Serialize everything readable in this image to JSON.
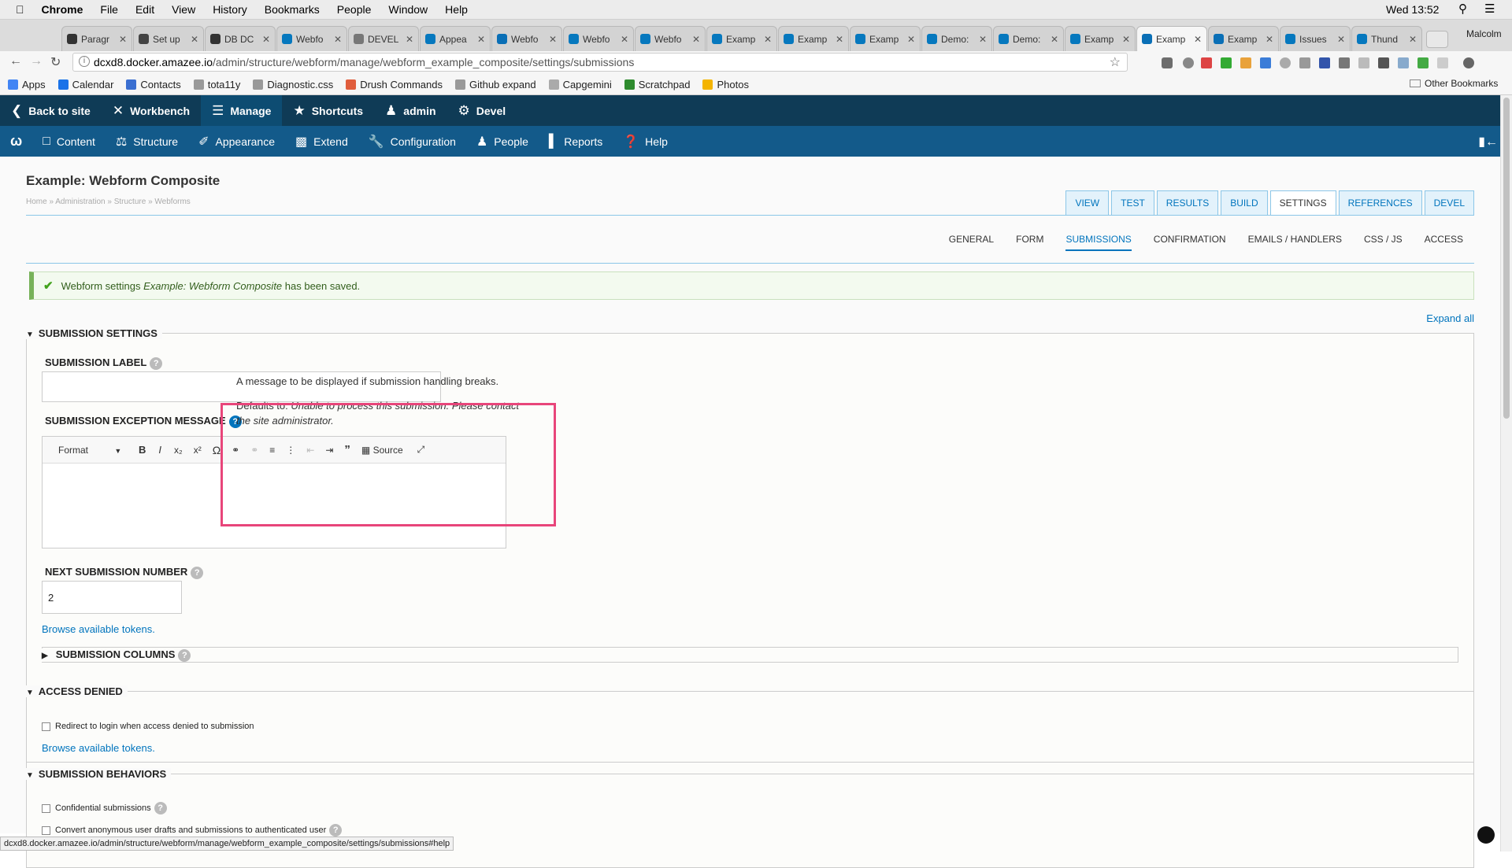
{
  "menubar": {
    "apple": "",
    "app": "Chrome",
    "items": [
      "File",
      "Edit",
      "View",
      "History",
      "Bookmarks",
      "People",
      "Window",
      "Help"
    ],
    "clock": "Wed 13:52"
  },
  "tabs": [
    {
      "label": "Paragr",
      "color": "#333"
    },
    {
      "label": "Set up",
      "color": "#444"
    },
    {
      "label": "DB DC",
      "color": "#333"
    },
    {
      "label": "Webfo",
      "color": "#0678be"
    },
    {
      "label": "DEVEL",
      "color": "#777"
    },
    {
      "label": "Appea",
      "color": "#0678be"
    },
    {
      "label": "Webfo",
      "color": "#0a6fb6"
    },
    {
      "label": "Webfo",
      "color": "#0678be"
    },
    {
      "label": "Webfo",
      "color": "#0678be"
    },
    {
      "label": "Examp",
      "color": "#0678be"
    },
    {
      "label": "Examp",
      "color": "#0678be"
    },
    {
      "label": "Examp",
      "color": "#0678be"
    },
    {
      "label": "Demo:",
      "color": "#0678be"
    },
    {
      "label": "Demo:",
      "color": "#0678be"
    },
    {
      "label": "Examp",
      "color": "#0678be"
    },
    {
      "label": "Examp",
      "color": "#0a6fb6",
      "active": true
    },
    {
      "label": "Examp",
      "color": "#0a6fb6"
    },
    {
      "label": "Issues",
      "color": "#0678be"
    },
    {
      "label": "Thund",
      "color": "#0678be"
    }
  ],
  "profile": "Malcolm",
  "url": {
    "host": "dcxd8.docker.amazee.io",
    "path": "/admin/structure/webform/manage/webform_example_composite/settings/submissions"
  },
  "bookmarks": [
    {
      "label": "Apps",
      "color": "#4285f4"
    },
    {
      "label": "Calendar",
      "color": "#1a73e8"
    },
    {
      "label": "Contacts",
      "color": "#3b6fd1"
    },
    {
      "label": "tota11y",
      "color": "#999"
    },
    {
      "label": "Diagnostic.css",
      "color": "#999"
    },
    {
      "label": "Drush Commands",
      "color": "#e05d3c"
    },
    {
      "label": "Github expand",
      "color": "#999"
    },
    {
      "label": "Capgemini",
      "color": "#aaa"
    },
    {
      "label": "Scratchpad",
      "color": "#2e8b2e"
    },
    {
      "label": "Photos",
      "color": "#f4b400"
    }
  ],
  "other_bookmarks": "Other Bookmarks",
  "toolbar": {
    "back": "Back to site",
    "workbench": "Workbench",
    "manage": "Manage",
    "shortcuts": "Shortcuts",
    "user": "admin",
    "devel": "Devel"
  },
  "admin_menu": [
    "Content",
    "Structure",
    "Appearance",
    "Extend",
    "Configuration",
    "People",
    "Reports",
    "Help"
  ],
  "page": {
    "title": "Example: Webform Composite",
    "breadcrumb": "Home » Administration » Structure » Webforms",
    "primary_tabs": [
      "VIEW",
      "TEST",
      "RESULTS",
      "BUILD",
      "SETTINGS",
      "REFERENCES",
      "DEVEL"
    ],
    "secondary_tabs": [
      "GENERAL",
      "FORM",
      "SUBMISSIONS",
      "CONFIRMATION",
      "EMAILS / HANDLERS",
      "CSS / JS",
      "ACCESS"
    ],
    "message_pre": "Webform settings ",
    "message_em": "Example: Webform Composite",
    "message_post": " has been saved.",
    "expand_all": "Expand all"
  },
  "submission_settings": {
    "legend": "SUBMISSION SETTINGS",
    "label_title": "SUBMISSION LABEL",
    "label_value": "",
    "exception_title": "SUBMISSION EXCEPTION MESSAGE",
    "editor_format": "Format",
    "editor_source": "Source",
    "tooltip_line1": "A message to be displayed if submission handling breaks.",
    "tooltip_defaults": "Defaults to: ",
    "tooltip_default_text": "Unable to process this submission. Please contact the site administrator.",
    "next_number_title": "NEXT SUBMISSION NUMBER",
    "next_number_value": "2",
    "tokens_link": "Browse available tokens.",
    "columns_title": "SUBMISSION COLUMNS"
  },
  "access_denied": {
    "legend": "ACCESS DENIED",
    "redirect_label": "Redirect to login when access denied to submission",
    "tokens_link": "Browse available tokens."
  },
  "behaviors": {
    "legend": "SUBMISSION BEHAVIORS",
    "confidential": "Confidential submissions",
    "convert": "Convert anonymous user drafts and submissions to authenticated user"
  },
  "status_url": "dcxd8.docker.amazee.io/admin/structure/webform/manage/webform_example_composite/settings/submissions#help",
  "highlight_color": "#e8457a"
}
